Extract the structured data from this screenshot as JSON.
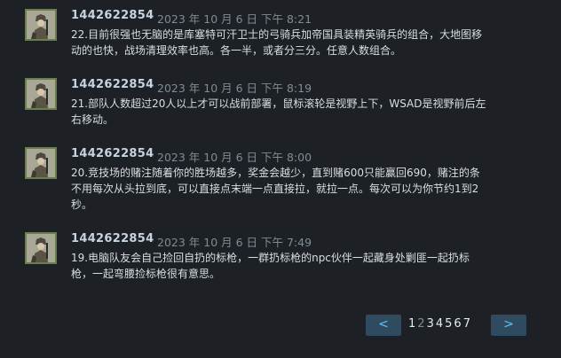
{
  "comments": [
    {
      "author": "1442622854",
      "timestamp": "2023 年 10 月 6 日 下午 8:21",
      "text": "22.目前很强也无脑的是库塞特可汗卫士的弓骑兵加帝国具装精英骑兵的组合，大地图移动的也快，战场清理效率也高。各一半，或者分三分。任意人数组合。"
    },
    {
      "author": "1442622854",
      "timestamp": "2023 年 10 月 6 日 下午 8:19",
      "text": "21.部队人数超过20人以上才可以战前部署，鼠标滚轮是视野上下，WSAD是视野前后左右移动。"
    },
    {
      "author": "1442622854",
      "timestamp": "2023 年 10 月 6 日 下午 8:00",
      "text": "20.竞技场的赌注随着你的胜场越多，奖金会越少，直到赌600只能赢回690，赌注的条不用每次从头拉到底，可以直接点末端一点直接拉，就拉一点。每次可以为你节约1到2秒。"
    },
    {
      "author": "1442622854",
      "timestamp": "2023 年 10 月 6 日 下午 7:49",
      "text": "19.电脑队友会自己捡回自扔的标枪，一群扔标枪的npc伙伴一起藏身处剿匪一起扔标枪，一起弯腰捡标枪很有意思。"
    }
  ],
  "pagination": {
    "prev_label": "<",
    "next_label": ">",
    "pages": [
      "1",
      "2",
      "3",
      "4",
      "5",
      "6",
      "7"
    ],
    "current": "2"
  },
  "icons": {
    "avatar": "soldier-avatar-icon",
    "prev": "chevron-left-icon",
    "next": "chevron-right-icon"
  },
  "colors": {
    "background": "#1d2025",
    "author": "#c6d4df",
    "timestamp": "#7f8c95",
    "text": "#d8dfe5",
    "pager_button_bg": "#2f4b60",
    "pager_button_fg": "#67c1f5",
    "avatar_border": "#6a7e4e"
  }
}
